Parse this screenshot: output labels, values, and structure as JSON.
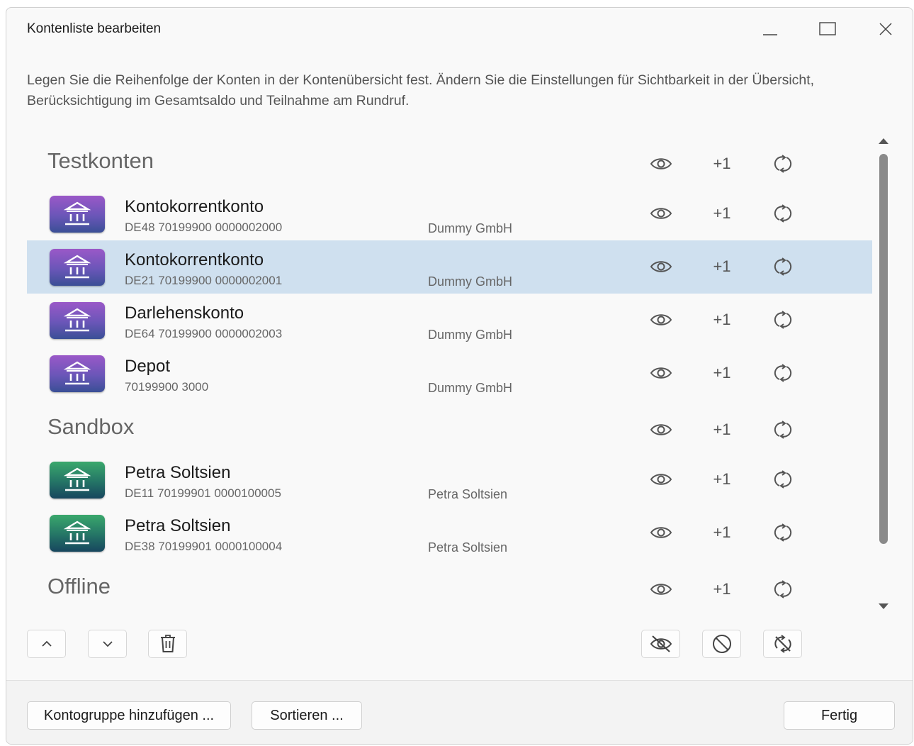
{
  "window": {
    "title": "Kontenliste bearbeiten"
  },
  "description": "Legen Sie die Reihenfolge der Konten in der Kontenübersicht fest. Ändern Sie die Einstellungen für Sichtbarkeit in der Übersicht, Berücksichtigung im Gesamtsaldo und Teilnahme am Rundruf.",
  "column_labels": {
    "total_balance": "+1"
  },
  "groups": {
    "testkonten": "Testkonten",
    "sandbox": "Sandbox",
    "offline": "Offline"
  },
  "accounts": [
    {
      "name": "Kontokorrentkonto",
      "iban": "DE48 70199900 0000002000",
      "owner": "Dummy GmbH",
      "color": "purple"
    },
    {
      "name": "Kontokorrentkonto",
      "iban": "DE21 70199900 0000002001",
      "owner": "Dummy GmbH",
      "color": "purple",
      "selected": true
    },
    {
      "name": "Darlehenskonto",
      "iban": "DE64 70199900 0000002003",
      "owner": "Dummy GmbH",
      "color": "purple"
    },
    {
      "name": "Depot",
      "iban": "70199900 3000",
      "owner": "Dummy GmbH",
      "color": "purple"
    },
    {
      "name": "Petra Soltsien",
      "iban": "DE11 70199901 0000100005",
      "owner": "Petra Soltsien",
      "color": "green"
    },
    {
      "name": "Petra Soltsien",
      "iban": "DE38 70199901 0000100004",
      "owner": "Petra Soltsien",
      "color": "green"
    }
  ],
  "footer": {
    "add_group": "Kontogruppe hinzufügen ...",
    "sort": "Sortieren ...",
    "done": "Fertig"
  },
  "colors": {
    "selected_row": "#cfe0ef",
    "purple_icon": "#6a56b8",
    "green_icon": "#247466"
  }
}
